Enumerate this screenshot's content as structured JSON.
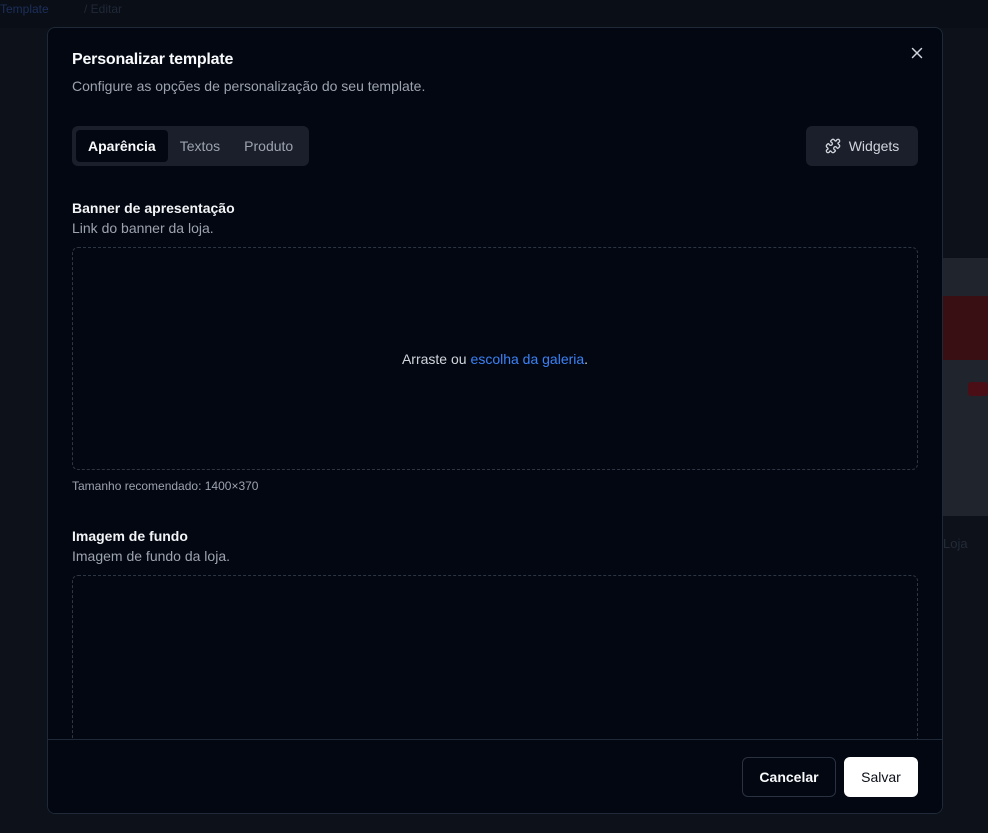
{
  "background": {
    "crumb_link": "Template",
    "crumb_muted": "/ Editar",
    "card_caption": "Loja"
  },
  "modal": {
    "title": "Personalizar template",
    "subtitle": "Configure as opções de personalização do seu template.",
    "close_icon": "close-icon",
    "tabs": [
      {
        "label": "Aparência",
        "active": true
      },
      {
        "label": "Textos",
        "active": false
      },
      {
        "label": "Produto",
        "active": false
      }
    ],
    "widgets_button": {
      "label": "Widgets",
      "icon": "puzzle-icon"
    },
    "banner": {
      "label": "Banner de apresentação",
      "description": "Link do banner da loja.",
      "drop_text": "Arraste ou",
      "drop_link": "escolha da galeria",
      "drop_suffix": ".",
      "hint": "Tamanho recomendado: 1400×370"
    },
    "background_image": {
      "label": "Imagem de fundo",
      "description": "Imagem de fundo da loja."
    },
    "footer": {
      "cancel_label": "Cancelar",
      "save_label": "Salvar"
    }
  },
  "colors": {
    "accent_link": "#3b82f6",
    "modal_bg": "#030712",
    "tab_bg": "#1a1f2b"
  }
}
